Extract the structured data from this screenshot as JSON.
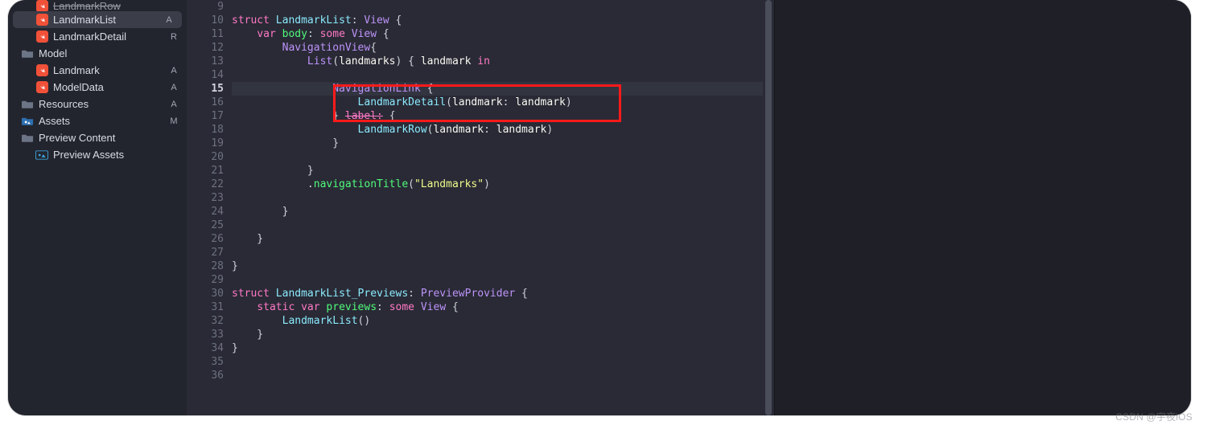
{
  "sidebar": {
    "items": [
      {
        "icon": "swift",
        "label": "LandmarkRow",
        "status": "",
        "indent": true,
        "selected": false,
        "truncated": true
      },
      {
        "icon": "swift",
        "label": "LandmarkList",
        "status": "A",
        "indent": true,
        "selected": true
      },
      {
        "icon": "swift",
        "label": "LandmarkDetail",
        "status": "R",
        "indent": true,
        "selected": false
      },
      {
        "icon": "folder",
        "label": "Model",
        "status": "",
        "indent": false,
        "selected": false
      },
      {
        "icon": "swift",
        "label": "Landmark",
        "status": "A",
        "indent": true,
        "selected": false
      },
      {
        "icon": "swift",
        "label": "ModelData",
        "status": "A",
        "indent": true,
        "selected": false
      },
      {
        "icon": "folder",
        "label": "Resources",
        "status": "A",
        "indent": false,
        "selected": false
      },
      {
        "icon": "assets",
        "label": "Assets",
        "status": "M",
        "indent": false,
        "selected": false
      },
      {
        "icon": "folder",
        "label": "Preview Content",
        "status": "",
        "indent": false,
        "selected": false
      },
      {
        "icon": "preview",
        "label": "Preview Assets",
        "status": "",
        "indent": true,
        "selected": false
      }
    ]
  },
  "editor": {
    "first_line_number": 9,
    "last_line_number": 36,
    "highlighted_line": 15,
    "red_box": {
      "from_line": 15,
      "to_line": 17
    },
    "lines": [
      "",
      "struct LandmarkList: View {",
      "    var body: some View {",
      "        NavigationView{",
      "            List(landmarks) { landmark in",
      "",
      "                NavigationLink {",
      "                    LandmarkDetail(landmark: landmark)",
      "                } label: {",
      "                    LandmarkRow(landmark: landmark)",
      "                }",
      "",
      "            }",
      "            .navigationTitle(\"Landmarks\")",
      "",
      "        }",
      "",
      "    }",
      "",
      "}",
      "",
      "struct LandmarkList_Previews: PreviewProvider {",
      "    static var previews: some View {",
      "        LandmarkList()",
      "    }",
      "}",
      "",
      ""
    ]
  },
  "watermark": "CSDN @宇夜iOS"
}
